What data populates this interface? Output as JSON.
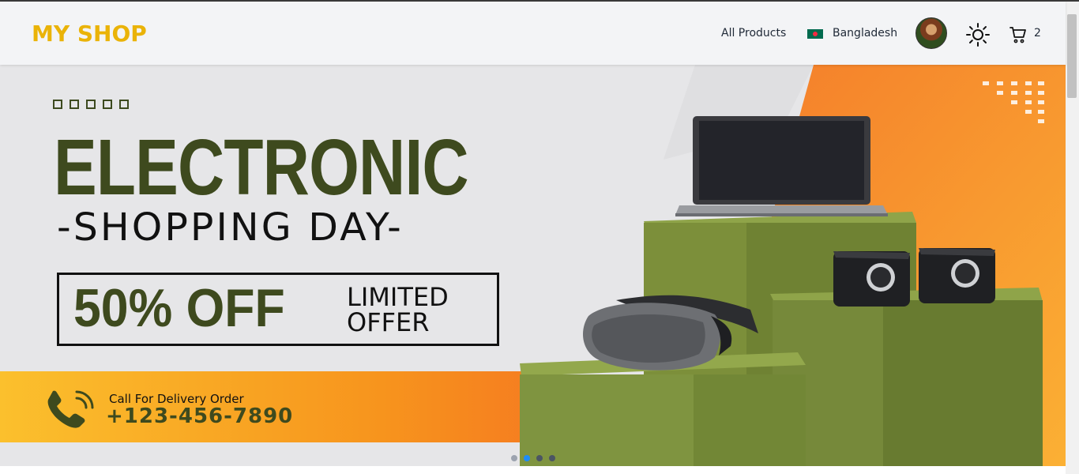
{
  "header": {
    "logo": "MY SHOP",
    "nav": {
      "all_products": "All Products",
      "country": "Bangladesh"
    },
    "cart_count": "2"
  },
  "banner": {
    "headline": "ELECTRONIC",
    "subheadline": "-SHOPPING DAY-",
    "offer_percent": "50% OFF",
    "offer_line1": "LIMITED",
    "offer_line2": "OFFER",
    "call_label": "Call For Delivery Order",
    "call_number": "+123-456-7890",
    "carousel": {
      "slides": 4,
      "active_index": 1
    }
  },
  "icons": {
    "flag": "bangladesh-flag-icon",
    "theme": "sun-icon",
    "cart": "cart-icon",
    "phone": "phone-icon"
  },
  "colors": {
    "logo": "#eab308",
    "headline": "#3e4a1e",
    "orange": "#f7941d",
    "carousel_active": "#1d8cf8"
  }
}
